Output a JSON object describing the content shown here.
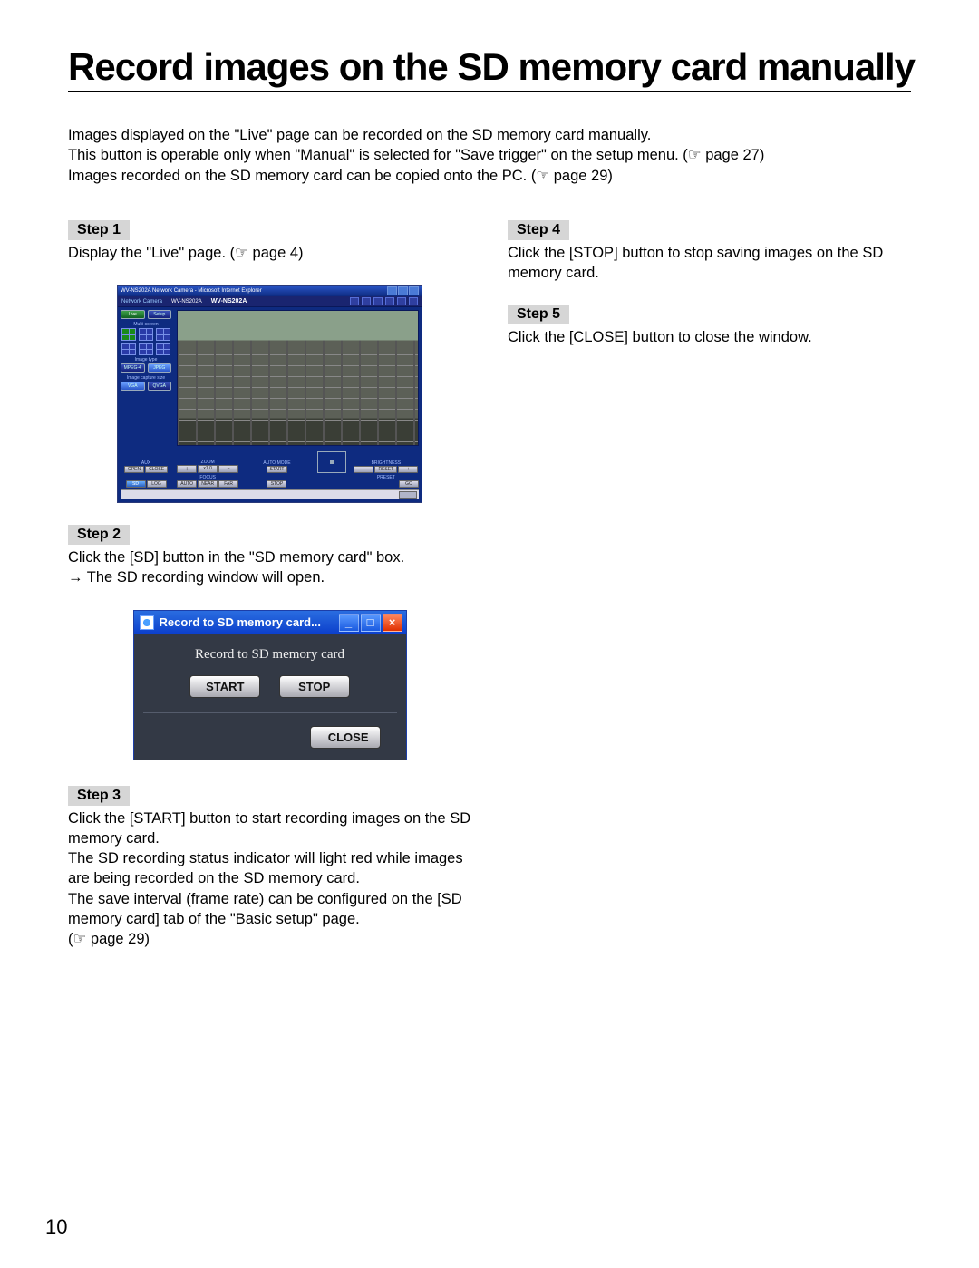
{
  "page_number": "10",
  "title": "Record images on the SD memory card manually",
  "intro": {
    "line1": "Images displayed on the \"Live\" page can be recorded on the SD memory card manually.",
    "line2_a": "This button is operable only when \"Manual\" is selected for \"Save trigger\" on the setup menu. (",
    "line2_ref": "page 27",
    "line2_b": ")",
    "line3_a": "Images recorded on the SD memory card can be copied onto the PC. (",
    "line3_ref": "page 29",
    "line3_b": ")"
  },
  "steps": {
    "s1": {
      "label": "Step 1",
      "body_a": "Display the \"Live\" page. (",
      "body_ref": "page 4",
      "body_b": ")"
    },
    "s2": {
      "label": "Step 2",
      "line1": "Click the [SD] button in the \"SD memory card\" box.",
      "line2": "The SD recording window will open."
    },
    "s3": {
      "label": "Step 3",
      "line1": "Click the [START] button to start recording images on the SD memory card.",
      "line2": "The SD recording status indicator will light red while images are being recorded on the SD memory card.",
      "line3": "The save interval (frame rate) can be configured on the [SD memory card] tab of the \"Basic setup\" page.",
      "line4_a": "(",
      "line4_ref": "page 29",
      "line4_b": ")"
    },
    "s4": {
      "label": "Step 4",
      "body": "Click the [STOP] button to stop saving images on the SD memory card."
    },
    "s5": {
      "label": "Step 5",
      "body": "Click the [CLOSE] button to close the window."
    }
  },
  "cam": {
    "title": "WV-NS202A Network Camera - Microsoft Internet Explorer",
    "vendor": "Network Camera",
    "model1": "WV-NS202A",
    "model2": "WV-NS202A",
    "side": {
      "live": "Live",
      "setup": "Setup",
      "multi": "Multi-screen",
      "imgtype": "Image type",
      "mjpeg": "MPEG-4",
      "jpeg": "JPEG",
      "imgcap": "Image capture size",
      "vga": "VGA",
      "qvga": "QVGA"
    },
    "bottom": {
      "aux": "AUX",
      "open": "OPEN",
      "close": "CLOSE",
      "sd": "SD",
      "log": "LOG",
      "zoom": "ZOOM",
      "zp": "＋",
      "zx": "x1.0",
      "zm": "−",
      "focus": "FOCUS",
      "auto": "AUTO",
      "near": "NEAR",
      "far": "FAR",
      "automode": "AUTO MODE",
      "start": "START",
      "stop": "STOP",
      "bright": "BRIGHTNESS",
      "reset": "RESET",
      "preset": "PRESET",
      "go": "GO"
    }
  },
  "sd": {
    "title": "Record to SD memory card...",
    "heading": "Record to SD memory card",
    "start": "START",
    "stop": "STOP",
    "close": "CLOSE",
    "min": "_",
    "max": "□",
    "x": "×"
  }
}
